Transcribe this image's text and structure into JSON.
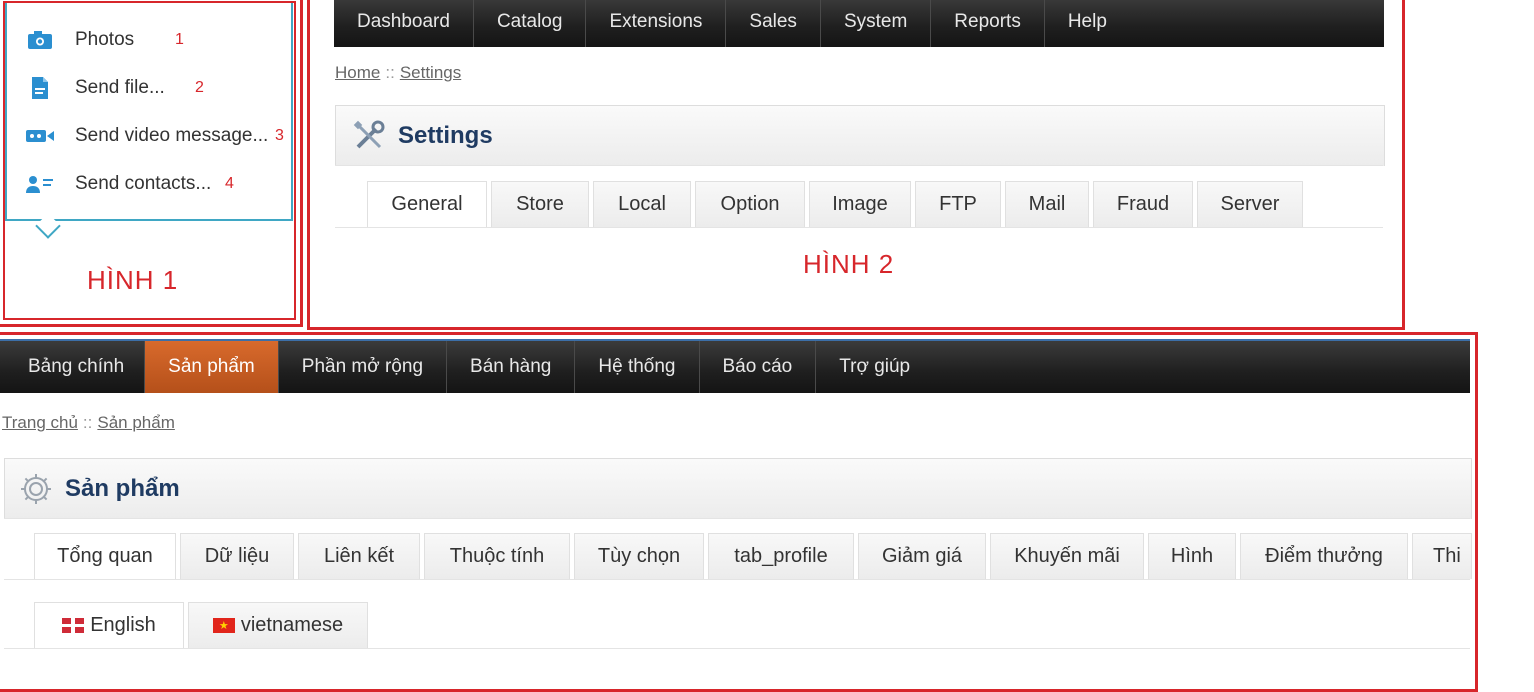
{
  "hinh1": {
    "label": "HÌNH 1",
    "items": [
      {
        "label": "Photos",
        "num": "1",
        "icon": "photos-icon"
      },
      {
        "label": "Send file...",
        "num": "2",
        "icon": "file-icon"
      },
      {
        "label": "Send video message...",
        "num": "3",
        "icon": "video-icon"
      },
      {
        "label": "Send contacts...",
        "num": "4",
        "icon": "contacts-icon"
      }
    ]
  },
  "hinh2": {
    "label": "HÌNH 2",
    "nav": [
      "Dashboard",
      "Catalog",
      "Extensions",
      "Sales",
      "System",
      "Reports",
      "Help"
    ],
    "breadcrumb": {
      "home": "Home",
      "sep": "::",
      "current": "Settings"
    },
    "title": "Settings",
    "title_icon": "tools-icon",
    "tabs": [
      "General",
      "Store",
      "Local",
      "Option",
      "Image",
      "FTP",
      "Mail",
      "Fraud",
      "Server"
    ],
    "active_tab": "General"
  },
  "hinh3": {
    "nav": [
      "Bảng chính",
      "Sản phẩm",
      "Phần mở rộng",
      "Bán hàng",
      "Hệ thống",
      "Báo cáo",
      "Trợ giúp"
    ],
    "active_nav": "Sản phẩm",
    "breadcrumb": {
      "home": "Trang chủ",
      "sep": "::",
      "current": "Sản phẩm"
    },
    "title": "Sản phẩm",
    "title_icon": "gear-icon",
    "tabs": [
      "Tổng quan",
      "Dữ liệu",
      "Liên kết",
      "Thuộc tính",
      "Tùy chọn",
      "tab_profile",
      "Giảm giá",
      "Khuyến mãi",
      "Hình",
      "Điểm thưởng",
      "Thi"
    ],
    "active_tab": "Tổng quan",
    "lang_tabs": [
      {
        "label": "English",
        "flag": "uk-flag-icon"
      },
      {
        "label": "vietnamese",
        "flag": "vn-flag-icon"
      }
    ],
    "active_lang": "English"
  },
  "colors": {
    "frame_red": "#d7262b",
    "popup_border": "#3fa7c4",
    "icon_blue": "#2b8fd0",
    "nav_active": "#c95f22",
    "title_blue": "#1f3b62"
  }
}
